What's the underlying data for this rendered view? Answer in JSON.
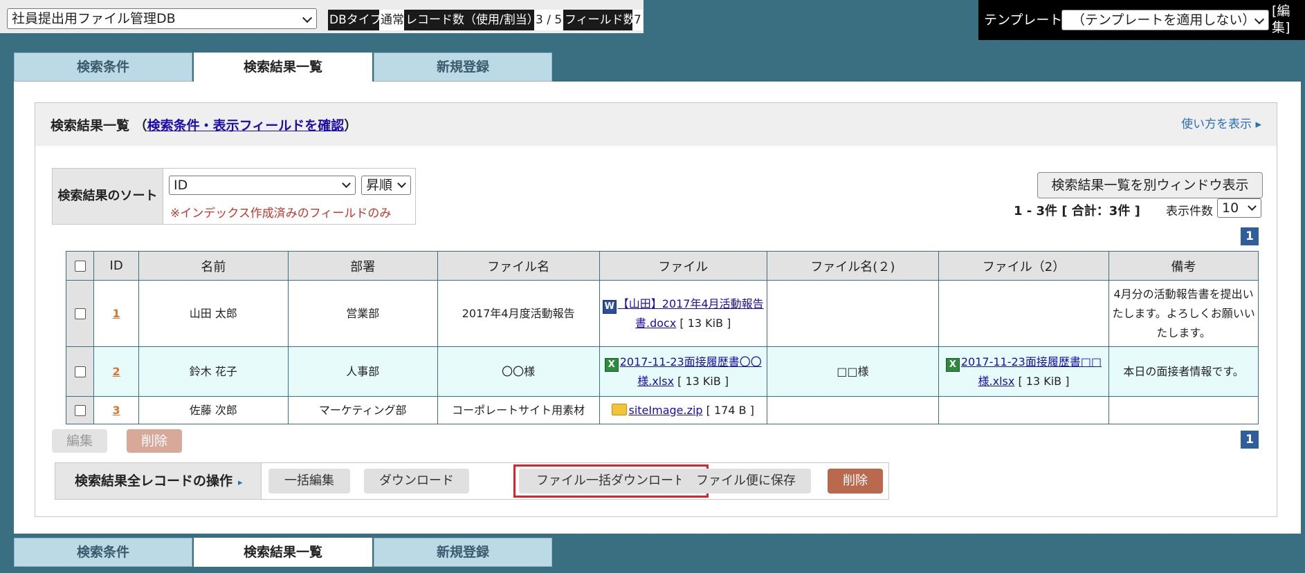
{
  "topbar": {
    "db_select_value": "社員提出用ファイル管理DB",
    "db_type_label": "DBタイプ",
    "db_type_value": "通常",
    "record_count_label": "レコード数（使用/割当）",
    "record_count_value": "3 / 5",
    "field_count_label": "フィールド数",
    "field_count_value": "7",
    "template_label": "テンプレート",
    "template_select_value": "（テンプレートを適用しない）",
    "template_edit_label": "[編集]"
  },
  "tabs": [
    {
      "label": "検索条件"
    },
    {
      "label": "検索結果一覧"
    },
    {
      "label": "新規登録"
    }
  ],
  "panel": {
    "title": "検索結果一覧 （",
    "title_link": "検索条件・表示フィールドを確認",
    "title_close": "）",
    "usage_link": "使い方を表示 ▸"
  },
  "sort": {
    "label": "検索結果のソート",
    "field_value": "ID",
    "order_value": "昇順",
    "note": "※インデックス作成済みのフィールドのみ"
  },
  "toolbar": {
    "open_window_label": "検索結果一覧を別ウィンドウ表示",
    "count_text": "1 - 3件 [ 合計：3件 ]",
    "per_page_label": "表示件数",
    "per_page_value": "10",
    "page_number": "1"
  },
  "table": {
    "headers": [
      "ID",
      "名前",
      "部署",
      "ファイル名",
      "ファイル",
      "ファイル名(２)",
      "ファイル（2）",
      "備考"
    ],
    "rows": [
      {
        "id": "1",
        "name": "山田 太郎",
        "dept": "営業部",
        "filename": "2017年4月度活動報告",
        "file_icon": "word-icon",
        "file_icon_glyph": "W",
        "file_link": "【山田】2017年4月活動報告書.docx",
        "file_size": "[ 13 KiB ]",
        "filename2": "",
        "file2_icon": "",
        "file2_icon_glyph": "",
        "file2_link": "",
        "file2_size": "",
        "note": "4月分の活動報告書を提出いたします。よろしくお願いいたします。"
      },
      {
        "id": "2",
        "name": "鈴木 花子",
        "dept": "人事部",
        "filename": "〇〇様",
        "file_icon": "excel-icon",
        "file_icon_glyph": "X",
        "file_link": "2017-11-23面接履歴書〇〇様.xlsx",
        "file_size": "[ 13 KiB ]",
        "filename2": "□□様",
        "file2_icon": "excel-icon",
        "file2_icon_glyph": "X",
        "file2_link": "2017-11-23面接履歴書□□様.xlsx",
        "file2_size": "[ 13 KiB ]",
        "note": "本日の面接者情報です。"
      },
      {
        "id": "3",
        "name": "佐藤 次郎",
        "dept": "マーケティング部",
        "filename": "コーポレートサイト用素材",
        "file_icon": "folder-icon",
        "file_icon_glyph": "",
        "file_link": "siteImage.zip",
        "file_size": "[ 174 B ]",
        "filename2": "",
        "file2_icon": "",
        "file2_icon_glyph": "",
        "file2_link": "",
        "file2_size": "",
        "note": ""
      }
    ]
  },
  "row_actions": {
    "edit_label": "編集",
    "delete_label": "削除"
  },
  "bulk_ops": {
    "label": "検索結果全レコードの操作",
    "arrow": "▸",
    "bulk_edit_label": "一括編集",
    "download_label": "ダウンロード",
    "file_bulk_download_label": "ファイル一括ダウンロード",
    "save_to_filebin_label": "ファイル便に保存",
    "delete_label": "削除"
  },
  "colors": {
    "accent": "#3a6f82",
    "tab_bg": "#bcd9e6",
    "highlight": "#e0202a",
    "delete_btn": "#b8694e",
    "page_badge": "#2e5f9c"
  }
}
